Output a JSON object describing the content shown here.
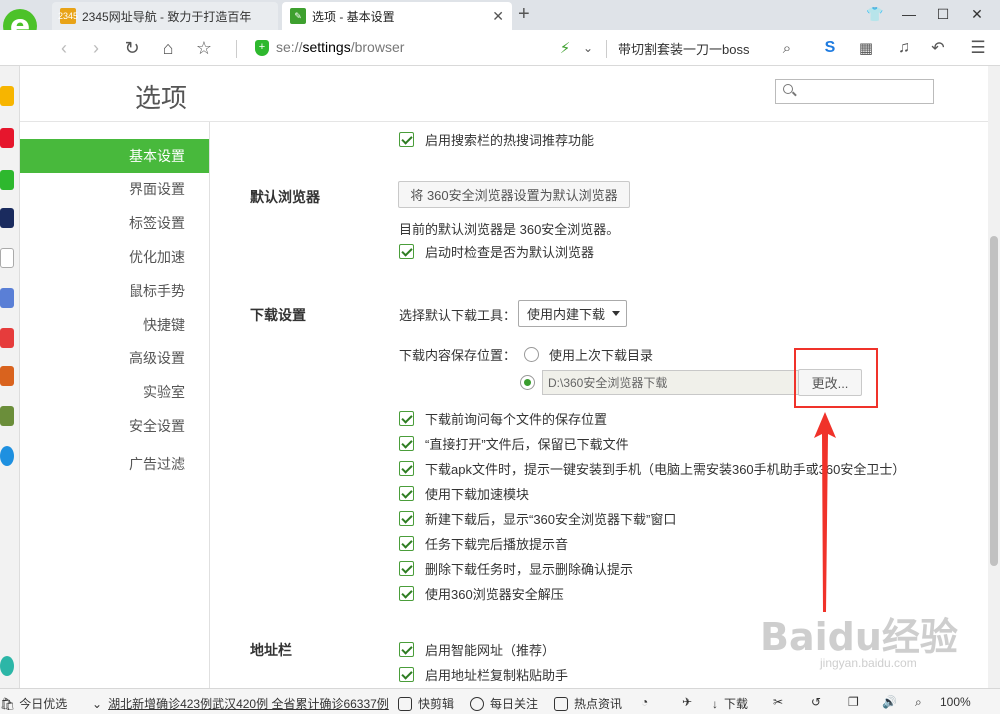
{
  "tabs": [
    {
      "label": "2345网址导航 - 致力于打造百年",
      "favicon": "2345"
    },
    {
      "label": "选项 - 基本设置",
      "favicon": "wrench"
    }
  ],
  "address_bar": {
    "url_prefix": "se://",
    "url_host": "settings",
    "url_path": "/browser",
    "search_text": "带切割套装一刀一boss"
  },
  "header": {
    "title": "选项",
    "search_placeholder": ""
  },
  "menu": [
    {
      "label": "基本设置",
      "active": true
    },
    {
      "label": "界面设置"
    },
    {
      "label": "标签设置"
    },
    {
      "label": "优化加速"
    },
    {
      "label": "鼠标手势"
    },
    {
      "label": "快捷键"
    },
    {
      "label": "高级设置"
    },
    {
      "label": "实验室"
    },
    {
      "label": "安全设置"
    },
    {
      "label": "广告过滤"
    }
  ],
  "content": {
    "top_partial": "启用搜索栏的热搜词推荐功能",
    "default_browser": {
      "title": "默认浏览器",
      "button": "将 360安全浏览器设置为默认浏览器",
      "status": "目前的默认浏览器是 360安全浏览器。",
      "check_on_start": "启动时检查是否为默认浏览器"
    },
    "download": {
      "title": "下载设置",
      "tool_label": "选择默认下载工具：",
      "tool_value": "使用内建下载",
      "save_label": "下载内容保存位置：",
      "radio_last": "使用上次下载目录",
      "path_value": "D:\\360安全浏览器下载",
      "change_button": "更改...",
      "options": [
        "下载前询问每个文件的保存位置",
        "“直接打开”文件后，保留已下载文件",
        "下载apk文件时，提示一键安装到手机（电脑上需安装360手机助手或360安全卫士）",
        "使用下载加速模块",
        "新建下载后，显示“360安全浏览器下载”窗口",
        "任务下载完后播放提示音",
        "删除下载任务时，显示删除确认提示",
        "使用360浏览器安全解压"
      ]
    },
    "address": {
      "title": "地址栏",
      "options": [
        "启用智能网址（推荐）",
        "启用地址栏复制粘贴助手"
      ]
    }
  },
  "statusbar": {
    "today": "今日优选",
    "news": "湖北新增确诊423例武汉420例 全省累计确诊66337例",
    "kuaijian": "快剪辑",
    "daily": "每日关注",
    "hot": "热点资讯",
    "download": "下载",
    "zoom": "100%"
  },
  "watermark": {
    "big": "Baidu经验",
    "small": "jingyan.baidu.com"
  },
  "colors": {
    "accent": "#48b93c",
    "annotation": "#f0322a"
  }
}
